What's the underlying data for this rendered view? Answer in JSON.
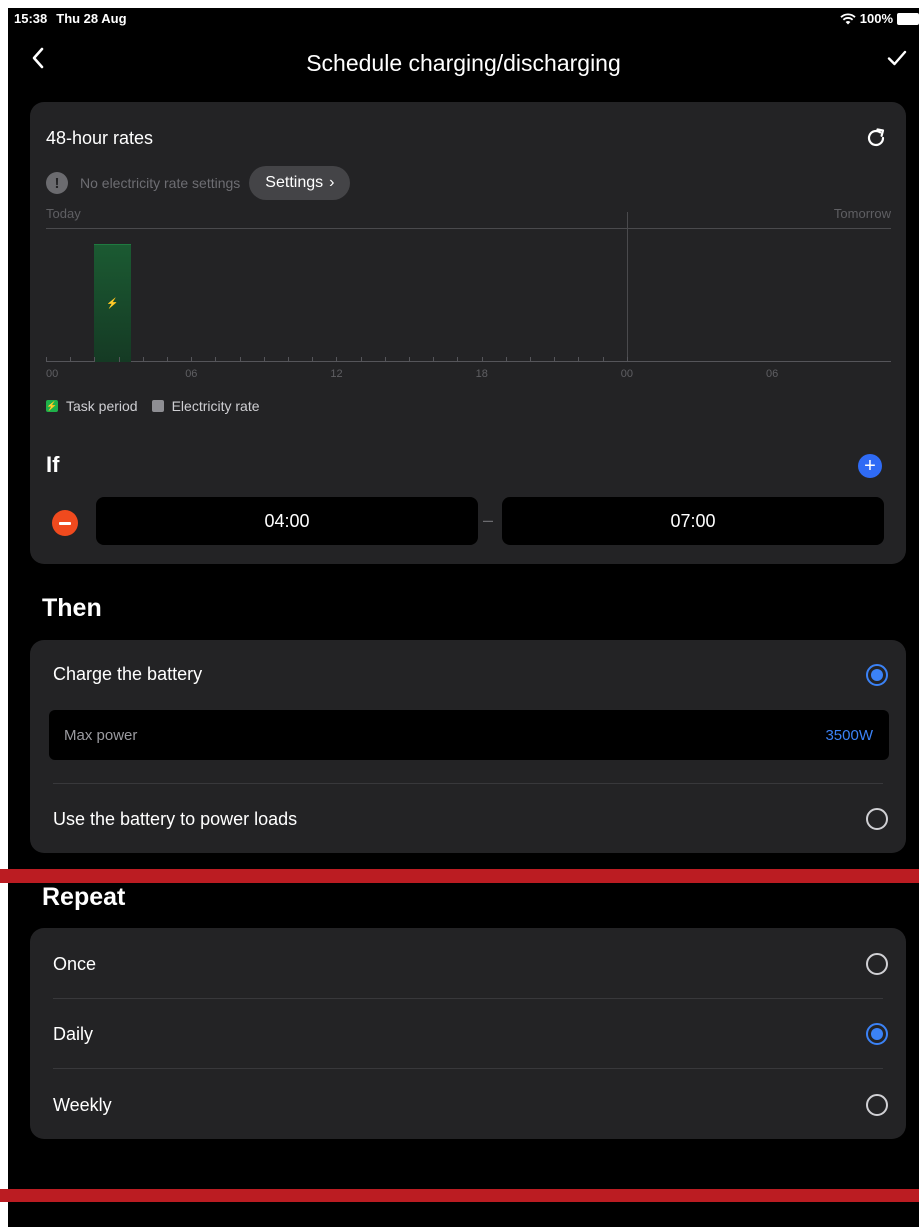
{
  "status_bar": {
    "time": "15:38",
    "date": "Thu 28 Aug",
    "battery": "100%"
  },
  "nav": {
    "title": "Schedule charging/discharging"
  },
  "rates": {
    "title": "48-hour rates",
    "warning": "No electricity rate settings",
    "settings_label": "Settings",
    "today_label": "Today",
    "tomorrow_label": "Tomorrow",
    "hour_labels": [
      "00",
      "06",
      "12",
      "18",
      "00",
      "06"
    ],
    "task_period_hours": [
      4,
      7
    ],
    "legend": {
      "task_period": "Task period",
      "electricity_rate": "Electricity rate"
    }
  },
  "if_section": {
    "label": "If",
    "start_time": "04:00",
    "separator": "–",
    "end_time": "07:00"
  },
  "then_section": {
    "title": "Then",
    "options": [
      {
        "label": "Charge the battery",
        "selected": true
      },
      {
        "label": "Use the battery to power loads",
        "selected": false
      }
    ],
    "max_power": {
      "label": "Max power",
      "value": "3500W"
    }
  },
  "repeat_section": {
    "title": "Repeat",
    "options": [
      {
        "label": "Once",
        "selected": false
      },
      {
        "label": "Daily",
        "selected": true
      },
      {
        "label": "Weekly",
        "selected": false
      }
    ]
  },
  "colors": {
    "accent": "#3b82f6",
    "remove": "#f04a1e",
    "task": "#1fb04a"
  }
}
